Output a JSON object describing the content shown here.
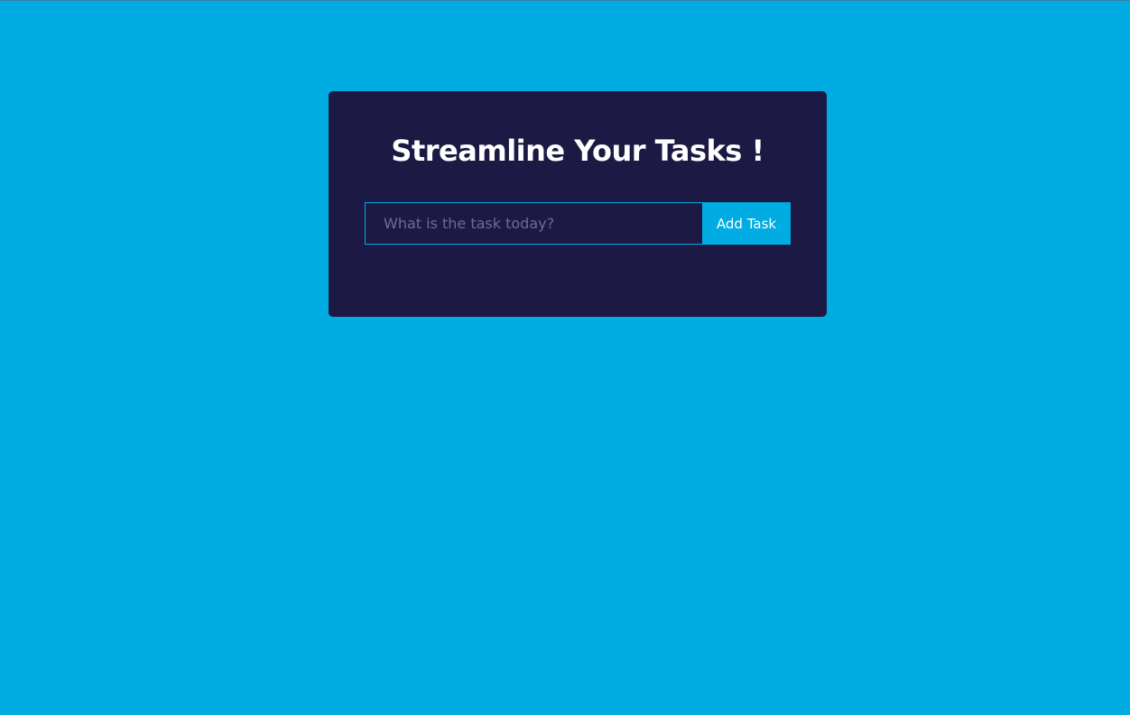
{
  "colors": {
    "background": "#00ACE2",
    "card": "#1C1A44",
    "accent": "#00ACE2",
    "text": "#FFFFFF",
    "placeholder": "#6E6C8E"
  },
  "todo_card": {
    "title": "Streamline Your Tasks !",
    "input": {
      "placeholder": "What is the task today?",
      "value": ""
    },
    "add_button_label": "Add Task"
  }
}
